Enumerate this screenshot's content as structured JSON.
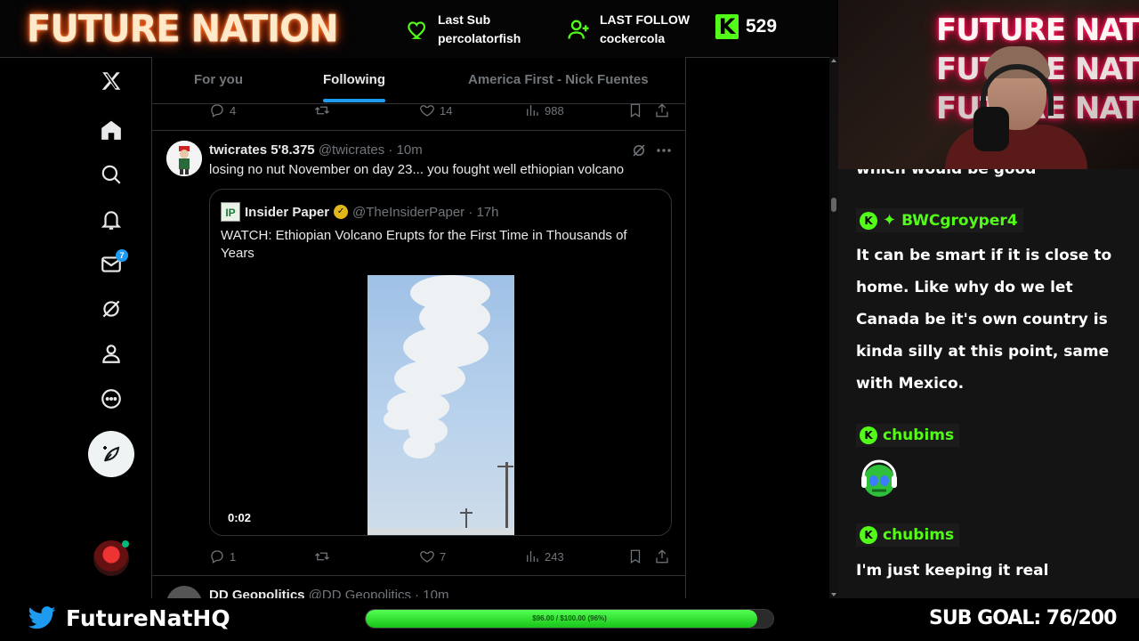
{
  "stream": {
    "brand": "FUTURE NATION",
    "last_sub_label": "Last Sub",
    "last_sub_name": "percolatorfish",
    "last_follow_label": "LAST FOLLOW",
    "last_follow_name": "cockercola",
    "kick_viewers": "529",
    "twitter_handle": "FutureNatHQ",
    "progress_label": "$96.00 / $100.00 (96%)",
    "progress_fraction": 0.96,
    "sub_goal": "SUB GOAL: 76/200",
    "accent": "#53fc18"
  },
  "nav": {
    "messages_badge": "7",
    "icons": [
      "x-logo-icon",
      "home-icon",
      "search-icon",
      "bell-icon",
      "mail-icon",
      "grok-icon",
      "profile-icon",
      "more-circle-icon",
      "post-feather-icon"
    ]
  },
  "feed": {
    "tabs": [
      "For you",
      "Following",
      "America First - Nick Fuentes"
    ],
    "active_tab": "Following",
    "prev_actions": {
      "replies": "4",
      "likes": "14",
      "views": "988"
    },
    "tweet": {
      "name": "twicrates 5'8.375",
      "handle": "@twicrates · 10m",
      "text": "losing no nut November on day 23... you fought well ethiopian volcano",
      "quote": {
        "logo": "IP",
        "name": "Insider Paper",
        "handle": "@TheInsiderPaper · 17h",
        "text": "WATCH: Ethiopian Volcano Erupts for the First Time in Thousands of Years",
        "video_time": "0:02"
      },
      "actions": {
        "replies": "1",
        "likes": "7",
        "views": "243"
      }
    },
    "next_tweet": {
      "name": "DD Geopolitics",
      "handle": "@DD Geopolitics · 10m"
    }
  },
  "chat": {
    "messages": [
      {
        "user": "",
        "text": "which would be good"
      },
      {
        "user": "BWCgroyper4",
        "text": "It can be smart if it is close to home. Like why do we let Canada be it's own country is kinda silly at this point, same with Mexico."
      },
      {
        "user": "chubims",
        "text": ""
      },
      {
        "user": "chubims",
        "text": "I'm just keeping it real"
      }
    ]
  }
}
